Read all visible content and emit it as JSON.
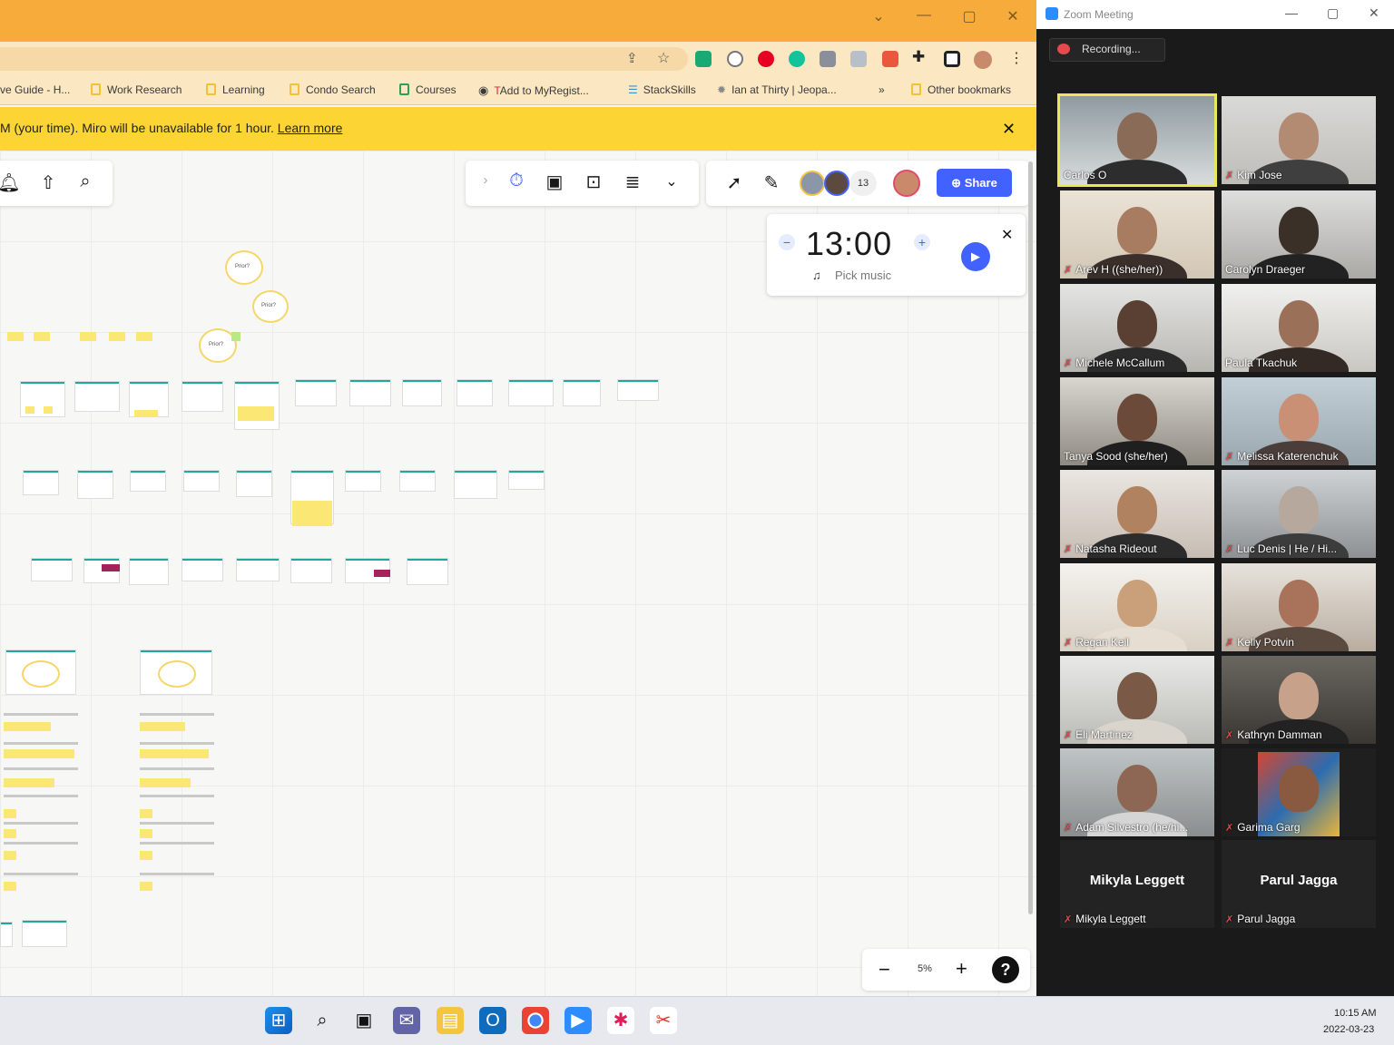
{
  "browser": {
    "bookmarks": [
      "ve Guide - H...",
      "Work Research",
      "Learning",
      "Condo Search",
      "Courses",
      "Add to MyRegist...",
      "StackSkills",
      "Ian at Thirty | Jeopa...",
      "Other bookmarks"
    ],
    "overflow": "»"
  },
  "banner": {
    "text": "M (your time). Miro will be unavailable for 1 hour.",
    "link": "Learn more",
    "close": "✕"
  },
  "miro": {
    "collaborators_count": "13",
    "share_label": "Share",
    "timer": {
      "value": "13:00",
      "minus": "−",
      "plus": "+",
      "music_label": "Pick music",
      "close": "✕"
    },
    "zoom": {
      "minus": "−",
      "level": "5%",
      "plus": "+",
      "help": "?"
    },
    "mindmap": [
      "Prior?",
      "Prior?",
      "Prior?"
    ]
  },
  "zoom": {
    "title": "Zoom Meeting",
    "recording": "Recording...",
    "participants": [
      {
        "name": "Carlos O",
        "muted": false
      },
      {
        "name": "Kim Jose",
        "muted": true
      },
      {
        "name": "Arev H ((she/her))",
        "muted": true
      },
      {
        "name": "Carolyn Draeger",
        "muted": false
      },
      {
        "name": "Michele McCallum",
        "muted": true
      },
      {
        "name": "Paula Tkachuk",
        "muted": false
      },
      {
        "name": "Tanya Sood (she/her)",
        "muted": false
      },
      {
        "name": "Melissa Katerenchuk",
        "muted": true
      },
      {
        "name": "Natasha Rideout",
        "muted": true
      },
      {
        "name": "Luc Denis   |   He / Hi...",
        "muted": true
      },
      {
        "name": "Regan Keil",
        "muted": true
      },
      {
        "name": "Kelly Potvin",
        "muted": true
      },
      {
        "name": "Eli Martinez",
        "muted": true
      },
      {
        "name": "Kathryn Damman",
        "muted": true
      },
      {
        "name": "Adam Silvestro (he/hi...",
        "muted": true
      },
      {
        "name": "Garima Garg",
        "muted": true
      },
      {
        "name": "Mikyla Leggett",
        "muted": true,
        "no_video": true
      },
      {
        "name": "Parul Jagga",
        "muted": true,
        "no_video": true
      }
    ]
  },
  "taskbar": {
    "time": "10:15 AM",
    "date": "2022-03-23"
  },
  "colors": {
    "browser_frame": "#f6ab3b",
    "banner": "#fcd535",
    "share": "#4262ff",
    "zoom_bg": "#1a1a1a",
    "active_speaker": "#e8e85a"
  }
}
